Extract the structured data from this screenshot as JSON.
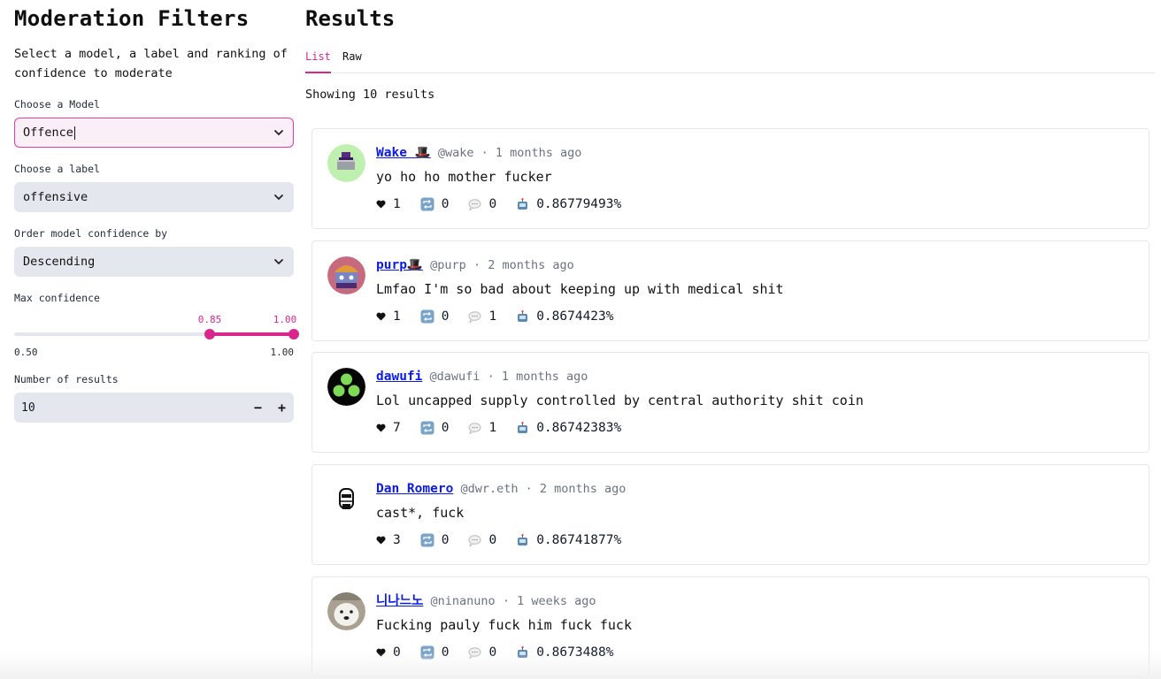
{
  "sidebar": {
    "title": "Moderation Filters",
    "intro": "Select a model, a label and ranking of confidence to moderate",
    "model": {
      "label": "Choose a Model",
      "value": "Offence"
    },
    "label_select": {
      "label": "Choose a label",
      "value": "offensive"
    },
    "order": {
      "label": "Order model confidence by",
      "value": "Descending"
    },
    "max_confidence": {
      "label": "Max confidence",
      "low": "0.85",
      "high": "1.00",
      "min": "0.50",
      "max": "1.00"
    },
    "num_results": {
      "label": "Number of results",
      "value": "10",
      "minus": "−",
      "plus": "+"
    }
  },
  "main": {
    "title": "Results",
    "tabs": [
      {
        "label": "List"
      },
      {
        "label": "Raw"
      }
    ],
    "showing": "Showing 10 results",
    "posts": [
      {
        "name": "Wake 🎩",
        "handle": "@wake",
        "dot": "·",
        "time": "1 months ago",
        "text": "yo ho ho mother fucker",
        "likes": "1",
        "recasts": "0",
        "replies": "0",
        "score": "0.86779493%"
      },
      {
        "name": "purp🎩",
        "handle": "@purp",
        "dot": "·",
        "time": "2 months ago",
        "text": "Lmfao I'm so bad about keeping up with medical shit",
        "likes": "1",
        "recasts": "0",
        "replies": "1",
        "score": "0.8674423%"
      },
      {
        "name": "dawufi",
        "handle": "@dawufi",
        "dot": "·",
        "time": "1 months ago",
        "text": "Lol uncapped supply controlled by central authority shit coin",
        "likes": "7",
        "recasts": "0",
        "replies": "1",
        "score": "0.86742383%"
      },
      {
        "name": "Dan Romero",
        "handle": "@dwr.eth",
        "dot": "·",
        "time": "2 months ago",
        "text": "cast*, fuck",
        "likes": "3",
        "recasts": "0",
        "replies": "0",
        "score": "0.86741877%"
      },
      {
        "name": "니나느노",
        "handle": "@ninanuno",
        "dot": "·",
        "time": "1 weeks ago",
        "text": "Fucking pauly fuck him fuck fuck",
        "likes": "0",
        "recasts": "0",
        "replies": "0",
        "score": "0.8673488%"
      }
    ]
  },
  "colors": {
    "accent": "#d9268c",
    "link": "#0b1be8",
    "input_bg": "#e5e7ef"
  },
  "icons": [
    "chevron-down-icon",
    "heart-icon",
    "recast-icon",
    "reply-icon",
    "robot-icon"
  ]
}
